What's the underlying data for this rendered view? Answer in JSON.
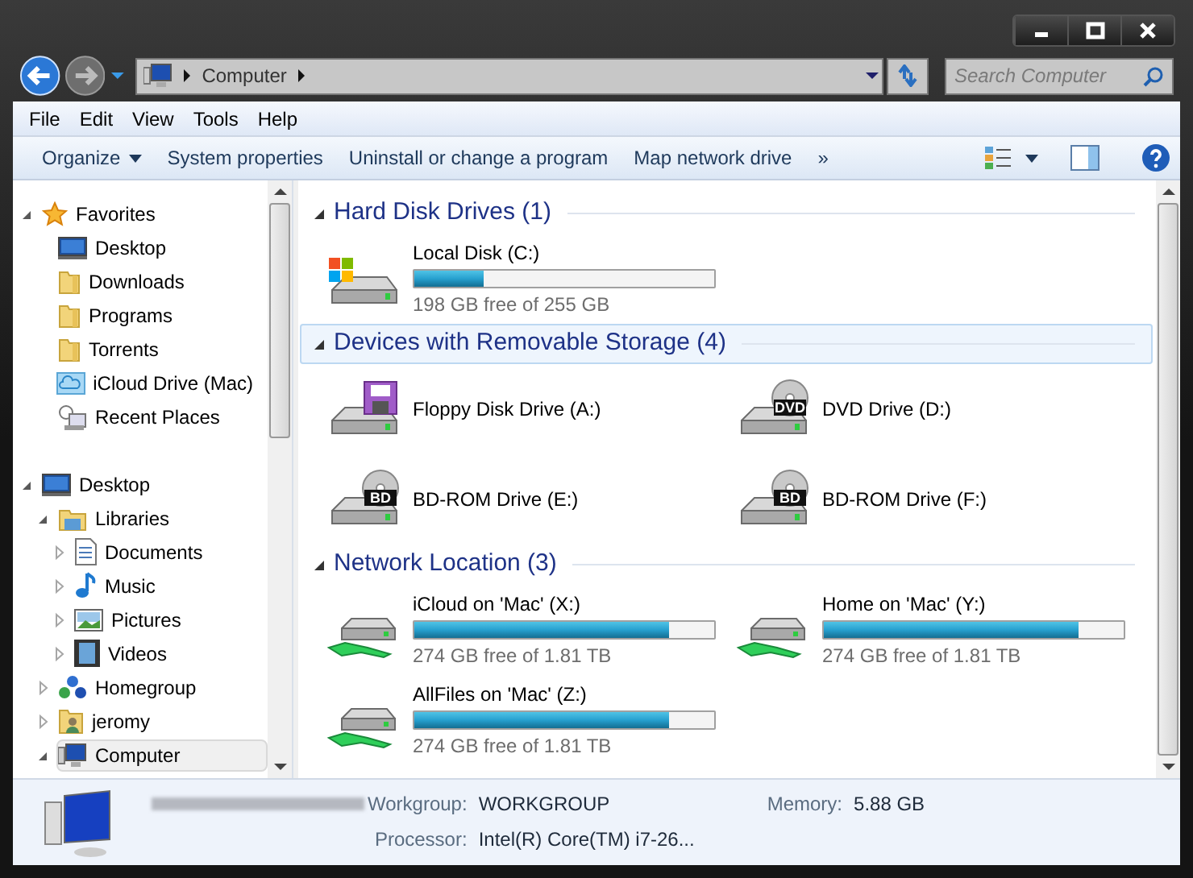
{
  "address_bar": {
    "path": [
      "Computer"
    ]
  },
  "search": {
    "placeholder": "Search Computer"
  },
  "menu": [
    "File",
    "Edit",
    "View",
    "Tools",
    "Help"
  ],
  "toolbar": [
    {
      "label": "Organize",
      "dropdown": true
    },
    {
      "label": "System properties",
      "dropdown": false
    },
    {
      "label": "Uninstall or change a program",
      "dropdown": false
    },
    {
      "label": "Map network drive",
      "dropdown": false
    },
    {
      "label": "»",
      "dropdown": false
    }
  ],
  "navigation": [
    {
      "label": "Favorites",
      "kind": "star",
      "expanded": true,
      "selected": false,
      "children": [
        {
          "label": "Desktop",
          "kind": "desktop",
          "selected": false
        },
        {
          "label": "Downloads",
          "kind": "folder",
          "selected": false
        },
        {
          "label": "Programs",
          "kind": "folder",
          "selected": false
        },
        {
          "label": "Torrents",
          "kind": "folder",
          "selected": false
        },
        {
          "label": "iCloud Drive (Mac)",
          "kind": "cloud",
          "selected": false
        },
        {
          "label": "Recent Places",
          "kind": "recent",
          "selected": false
        }
      ]
    },
    {
      "label": "Desktop",
      "kind": "desktop",
      "expanded": true,
      "selected": false,
      "children": [
        {
          "label": "Libraries",
          "kind": "library",
          "expanded": true,
          "selected": false,
          "children": [
            {
              "label": "Documents",
              "kind": "document",
              "expanded": false,
              "selected": false
            },
            {
              "label": "Music",
              "kind": "music",
              "expanded": false,
              "selected": false
            },
            {
              "label": "Pictures",
              "kind": "pictures",
              "expanded": false,
              "selected": false
            },
            {
              "label": "Videos",
              "kind": "videos",
              "expanded": false,
              "selected": false
            }
          ]
        },
        {
          "label": "Homegroup",
          "kind": "homegroup",
          "expanded": false,
          "selected": false
        },
        {
          "label": "jeromy",
          "kind": "user",
          "expanded": false,
          "selected": false
        },
        {
          "label": "Computer",
          "kind": "computer",
          "expanded": true,
          "selected": true
        }
      ]
    }
  ],
  "sections": [
    {
      "title": "Hard Disk Drives (1)",
      "selected": false,
      "items": [
        {
          "name": "Local Disk (C:)",
          "kind": "system",
          "level": 0.23,
          "free": "198 GB free of 255 GB"
        }
      ]
    },
    {
      "title": "Devices with Removable Storage (4)",
      "selected": true,
      "items": [
        {
          "name": "Floppy Disk Drive (A:)",
          "kind": "floppy"
        },
        {
          "name": "DVD Drive (D:)",
          "kind": "optical",
          "disc_label": "DVD"
        },
        {
          "name": "BD-ROM Drive (E:)",
          "kind": "optical",
          "disc_label": "BD"
        },
        {
          "name": "BD-ROM Drive (F:)",
          "kind": "optical",
          "disc_label": "BD"
        }
      ]
    },
    {
      "title": "Network Location (3)",
      "selected": false,
      "items": [
        {
          "name": "iCloud on 'Mac' (X:)",
          "kind": "network",
          "level": 0.85,
          "free": "274 GB free of 1.81 TB"
        },
        {
          "name": "Home on 'Mac' (Y:)",
          "kind": "network",
          "level": 0.85,
          "free": "274 GB free of 1.81 TB"
        },
        {
          "name": "AllFiles on 'Mac' (Z:)",
          "kind": "network",
          "level": 0.85,
          "free": "274 GB free of 1.81 TB"
        }
      ]
    }
  ],
  "details": {
    "fields": [
      {
        "label": "Workgroup:",
        "value": "WORKGROUP"
      },
      {
        "label": "Memory:",
        "value": "5.88 GB"
      },
      {
        "label": "Processor:",
        "value": "Intel(R) Core(TM) i7-26..."
      }
    ]
  }
}
